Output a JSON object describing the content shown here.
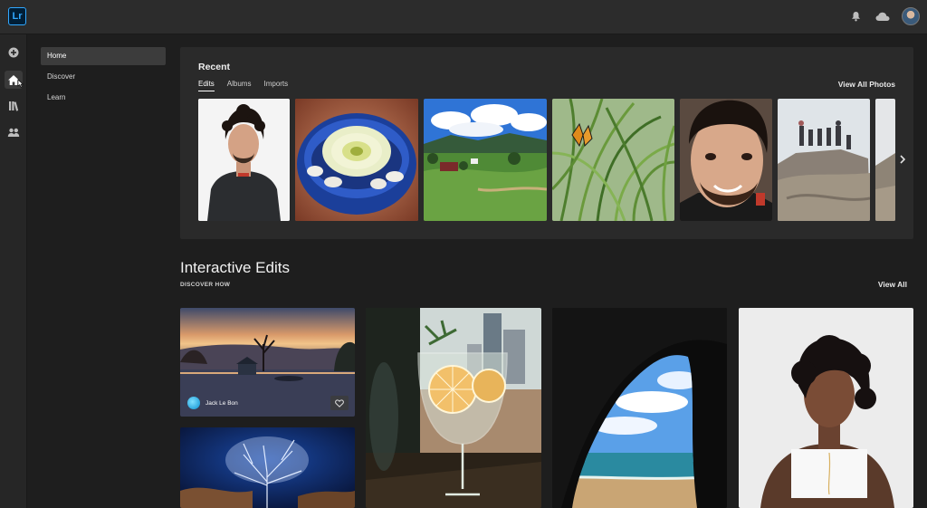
{
  "app": {
    "logo_text": "Lr"
  },
  "topbar": {
    "icons": [
      "bell-icon",
      "cloud-icon",
      "avatar"
    ]
  },
  "rail": {
    "icons": [
      "add-icon",
      "home-icon",
      "library-icon",
      "people-icon"
    ],
    "active": "home-icon"
  },
  "sidebar": {
    "items": [
      {
        "label": "Home",
        "active": true
      },
      {
        "label": "Discover",
        "active": false
      },
      {
        "label": "Learn",
        "active": false
      }
    ]
  },
  "recent": {
    "title": "Recent",
    "tabs": [
      {
        "label": "Edits",
        "active": true
      },
      {
        "label": "Albums",
        "active": false
      },
      {
        "label": "Imports",
        "active": false
      }
    ],
    "view_all_label": "View All Photos"
  },
  "interactive_edits": {
    "title": "Interactive Edits",
    "subtitle": "DISCOVER HOW",
    "view_all_label": "View All",
    "first_card_author": "Jack Le Bon"
  }
}
